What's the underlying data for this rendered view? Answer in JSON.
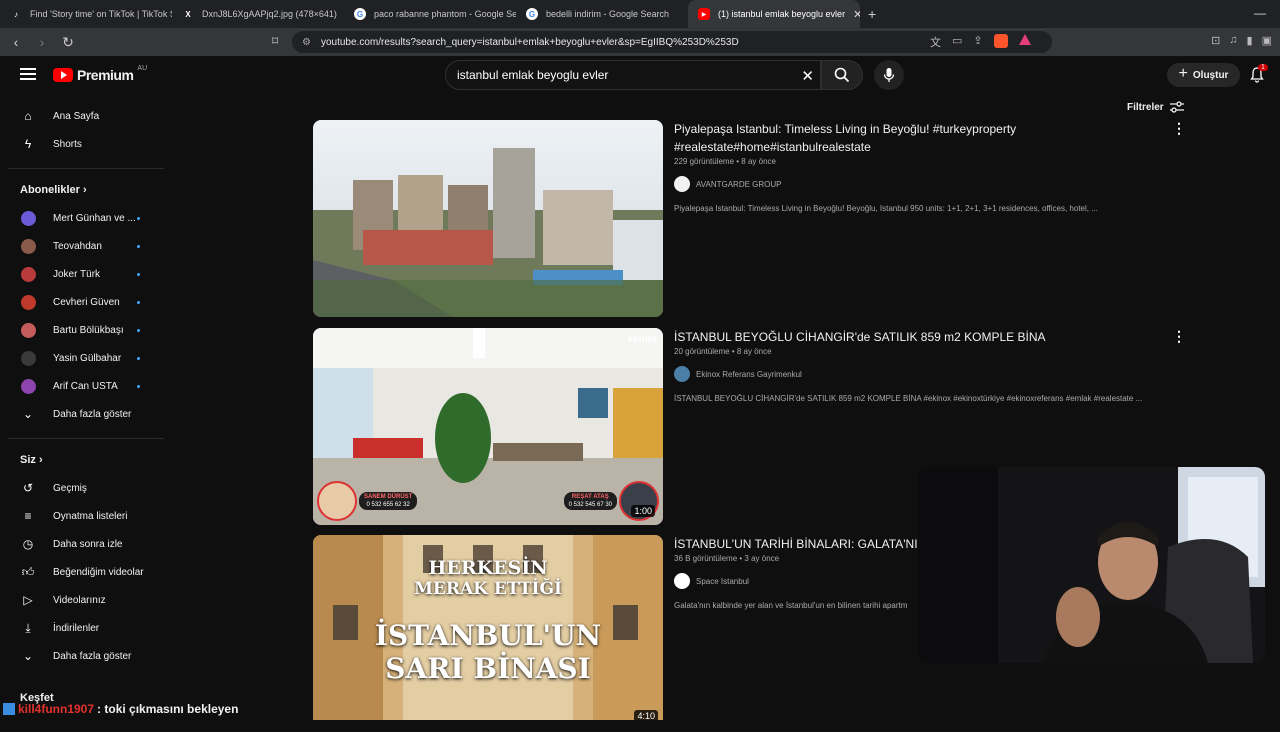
{
  "browser": {
    "tabs": [
      {
        "label": "Find 'Story time' on TikTok | TikTok S",
        "icon": "tiktok-icon",
        "active": false
      },
      {
        "label": "DxnJ8L6XgAAPjq2.jpg (478×641)",
        "icon": "x-icon",
        "active": false
      },
      {
        "label": "paco rabanne phantom - Google Sea",
        "icon": "google-icon",
        "active": false
      },
      {
        "label": "bedelli indirim - Google Search",
        "icon": "google-icon",
        "active": false
      },
      {
        "label": "(1) istanbul emlak beyoglu evler",
        "icon": "youtube-icon",
        "active": true
      }
    ],
    "url": "youtube.com/results?search_query=istanbul+emlak+beyoglu+evler&sp=EgIIBQ%253D%253D"
  },
  "header": {
    "logo_text": "Premium",
    "logo_region": "AU",
    "search_query": "istanbul emlak beyoglu evler",
    "create_label": "Oluştur",
    "notification_count": "1"
  },
  "sidebar": {
    "main": [
      {
        "label": "Ana Sayfa",
        "icon": "home-icon"
      },
      {
        "label": "Shorts",
        "icon": "shorts-icon"
      }
    ],
    "subscriptions_title": "Abonelikler",
    "subscriptions": [
      {
        "label": "Mert Günhan ve ...",
        "color": "#6b5bd6"
      },
      {
        "label": "Teovahdan",
        "color": "#8a5b4a"
      },
      {
        "label": "Joker Türk",
        "color": "#b83a3a"
      },
      {
        "label": "Cevheri Güven",
        "color": "#c0392b"
      },
      {
        "label": "Bartu Bölükbaşı",
        "color": "#c45c5c"
      },
      {
        "label": "Yasin Gülbahar",
        "color": "#2a2a2a"
      },
      {
        "label": "Arif Can USTA",
        "color": "#8e44ad"
      }
    ],
    "show_more_1": "Daha fazla göster",
    "you_title": "Siz",
    "you_items": [
      {
        "label": "Geçmiş",
        "icon": "history-icon"
      },
      {
        "label": "Oynatma listeleri",
        "icon": "playlist-icon"
      },
      {
        "label": "Daha sonra izle",
        "icon": "clock-icon"
      },
      {
        "label": "Beğendiğim videolar",
        "icon": "thumbs-up-icon"
      },
      {
        "label": "Videolarınız",
        "icon": "video-icon"
      },
      {
        "label": "İndirilenler",
        "icon": "download-icon"
      }
    ],
    "show_more_2": "Daha fazla göster",
    "explore_title": "Keşfet"
  },
  "filters_label": "Filtreler",
  "videos": [
    {
      "title": "Piyalepaşa Istanbul: Timeless Living in Beyoğlu! #turkeyproperty #realestate#home#istanbulrealestate",
      "meta": "229 görüntüleme • 8 ay önce",
      "channel": "AVANTGARDE GROUP",
      "description": "Piyalepaşa Istanbul: Timeless Living in Beyoğlu! Beyoğlu, Istanbul 950 units: 1+1, 2+1, 3+1 residences, offices, hotel, ..."
    },
    {
      "title": "İSTANBUL BEYOĞLU CİHANGİR'de SATILIK 859 m2 KOMPLE BİNA",
      "meta": "20 görüntüleme • 8 ay önce",
      "channel": "Ekinox Referans Gayrimenkul",
      "description": "İSTANBUL BEYOĞLU CİHANGİR'de SATILIK 859 m2 KOMPLE BİNA #ekinox #ekinoxtürkiye #ekinoxreferans #emlak #realestate ...",
      "duration": "1:00",
      "thumb_logo": "ekinot",
      "agent_left_name": "SANEM DÜRÜST",
      "agent_left_phone": "0 532 655 62 32",
      "agent_right_name": "REŞAT ATAŞ",
      "agent_right_phone": "0 532 545 67 30"
    },
    {
      "title": "İSTANBUL'UN TARİHİ BİNALARI: GALATA'NI",
      "meta": "36 B görüntüleme • 3 ay önce",
      "channel": "Space Istanbul",
      "description": "Galata'nın kalbinde yer alan ve İstanbul'un en bilinen tarihi apartm",
      "thumb_line1": "HERKESİN",
      "thumb_line2": "MERAK ETTİĞİ",
      "thumb_line3": "İSTANBUL'UN",
      "thumb_line4": "SARI BİNASI",
      "duration": "4:10"
    }
  ],
  "chat": {
    "user": "kill4funn1907",
    "message": ": toki çıkmasını bekleyen"
  }
}
